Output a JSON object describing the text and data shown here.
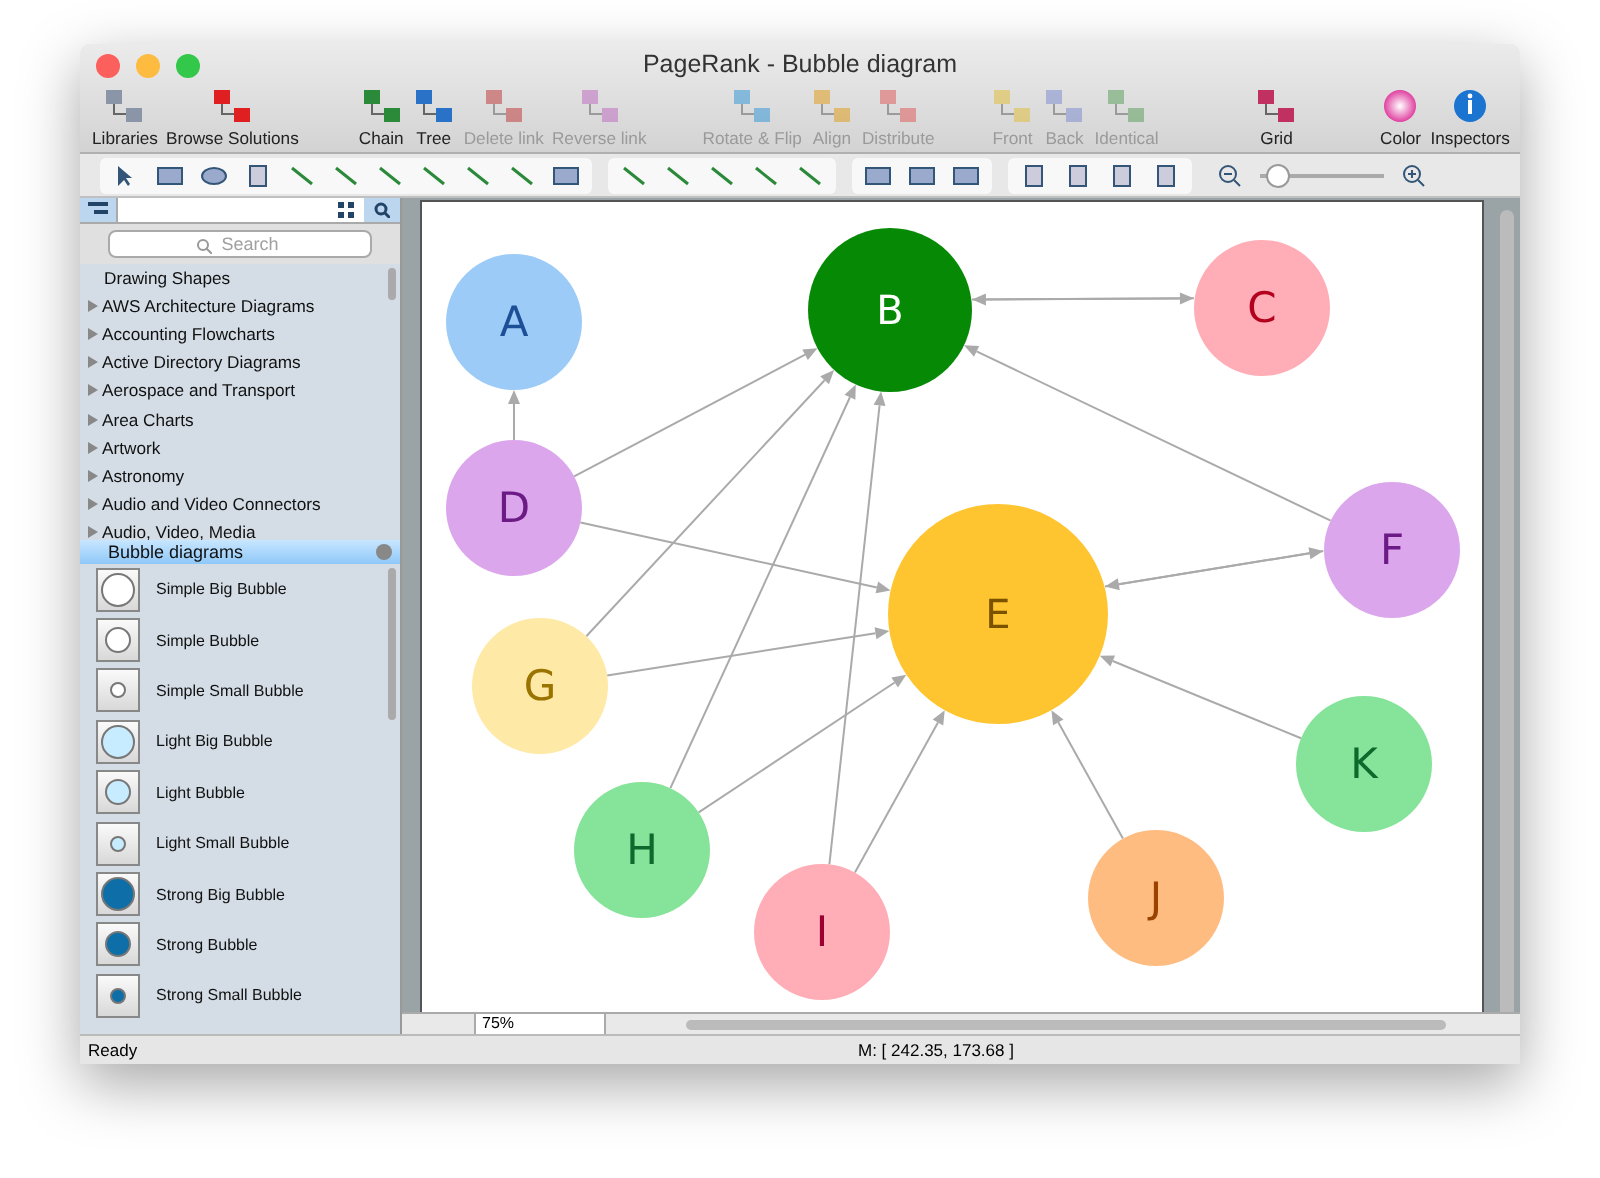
{
  "window": {
    "title": "PageRank - Bubble diagram"
  },
  "toolbar": [
    {
      "label": "Libraries",
      "disabled": false
    },
    {
      "label": "Browse Solutions",
      "disabled": false
    },
    {
      "label": "Chain",
      "disabled": false
    },
    {
      "label": "Tree",
      "disabled": false
    },
    {
      "label": "Delete link",
      "disabled": true
    },
    {
      "label": "Reverse link",
      "disabled": true
    },
    {
      "label": "Rotate & Flip",
      "disabled": true
    },
    {
      "label": "Align",
      "disabled": true
    },
    {
      "label": "Distribute",
      "disabled": true
    },
    {
      "label": "Front",
      "disabled": true
    },
    {
      "label": "Back",
      "disabled": true
    },
    {
      "label": "Identical",
      "disabled": true
    },
    {
      "label": "Grid",
      "disabled": false
    },
    {
      "label": "Color",
      "disabled": false
    },
    {
      "label": "Inspectors",
      "disabled": false
    }
  ],
  "zoom_slider": {
    "level": 0.15
  },
  "sidebar": {
    "search": {
      "placeholder": "Search"
    },
    "libraries": [
      {
        "label": "Drawing Shapes",
        "kind": "plain"
      },
      {
        "label": "AWS Architecture Diagrams",
        "kind": "folder"
      },
      {
        "label": "Accounting Flowcharts",
        "kind": "folder"
      },
      {
        "label": "Active Directory Diagrams",
        "kind": "folder"
      },
      {
        "label": "Aerospace and Transport",
        "kind": "folder"
      },
      {
        "label": "Area Charts",
        "kind": "folder"
      },
      {
        "label": "Artwork",
        "kind": "folder"
      },
      {
        "label": "Astronomy",
        "kind": "folder"
      },
      {
        "label": "Audio and Video Connectors",
        "kind": "folder"
      },
      {
        "label": "Audio, Video, Media",
        "kind": "folder"
      }
    ],
    "open_library": "Bubble diagrams",
    "shapes": [
      {
        "label": "Simple Big Bubble",
        "kind": "simple"
      },
      {
        "label": "Simple Bubble",
        "kind": "simple"
      },
      {
        "label": "Simple Small Bubble",
        "kind": "simple"
      },
      {
        "label": "Light Big Bubble",
        "kind": "light"
      },
      {
        "label": "Light Bubble",
        "kind": "light"
      },
      {
        "label": "Light Small Bubble",
        "kind": "light"
      },
      {
        "label": "Strong Big Bubble",
        "kind": "strong"
      },
      {
        "label": "Strong Bubble",
        "kind": "strong"
      },
      {
        "label": "Strong Small Bubble",
        "kind": "strong"
      }
    ]
  },
  "diagram": {
    "bubbles": [
      {
        "label": "A",
        "color": "#9ccbf8"
      },
      {
        "label": "B",
        "color": "#068a06"
      },
      {
        "label": "C",
        "color": "#ffadb6"
      },
      {
        "label": "D",
        "color": "#dba6ec"
      },
      {
        "label": "E",
        "color": "#ffc530"
      },
      {
        "label": "F",
        "color": "#dba6ec"
      },
      {
        "label": "G",
        "color": "#ffe9a6"
      },
      {
        "label": "H",
        "color": "#86e39a"
      },
      {
        "label": "I",
        "color": "#ffadb6"
      },
      {
        "label": "J",
        "color": "#ffbc80"
      },
      {
        "label": "K",
        "color": "#86e39a"
      }
    ]
  },
  "canvas_bar": {
    "zoom": "75%"
  },
  "status_bar": {
    "status": "Ready",
    "coordinates": "M: [ 242.35, 173.68 ]"
  }
}
